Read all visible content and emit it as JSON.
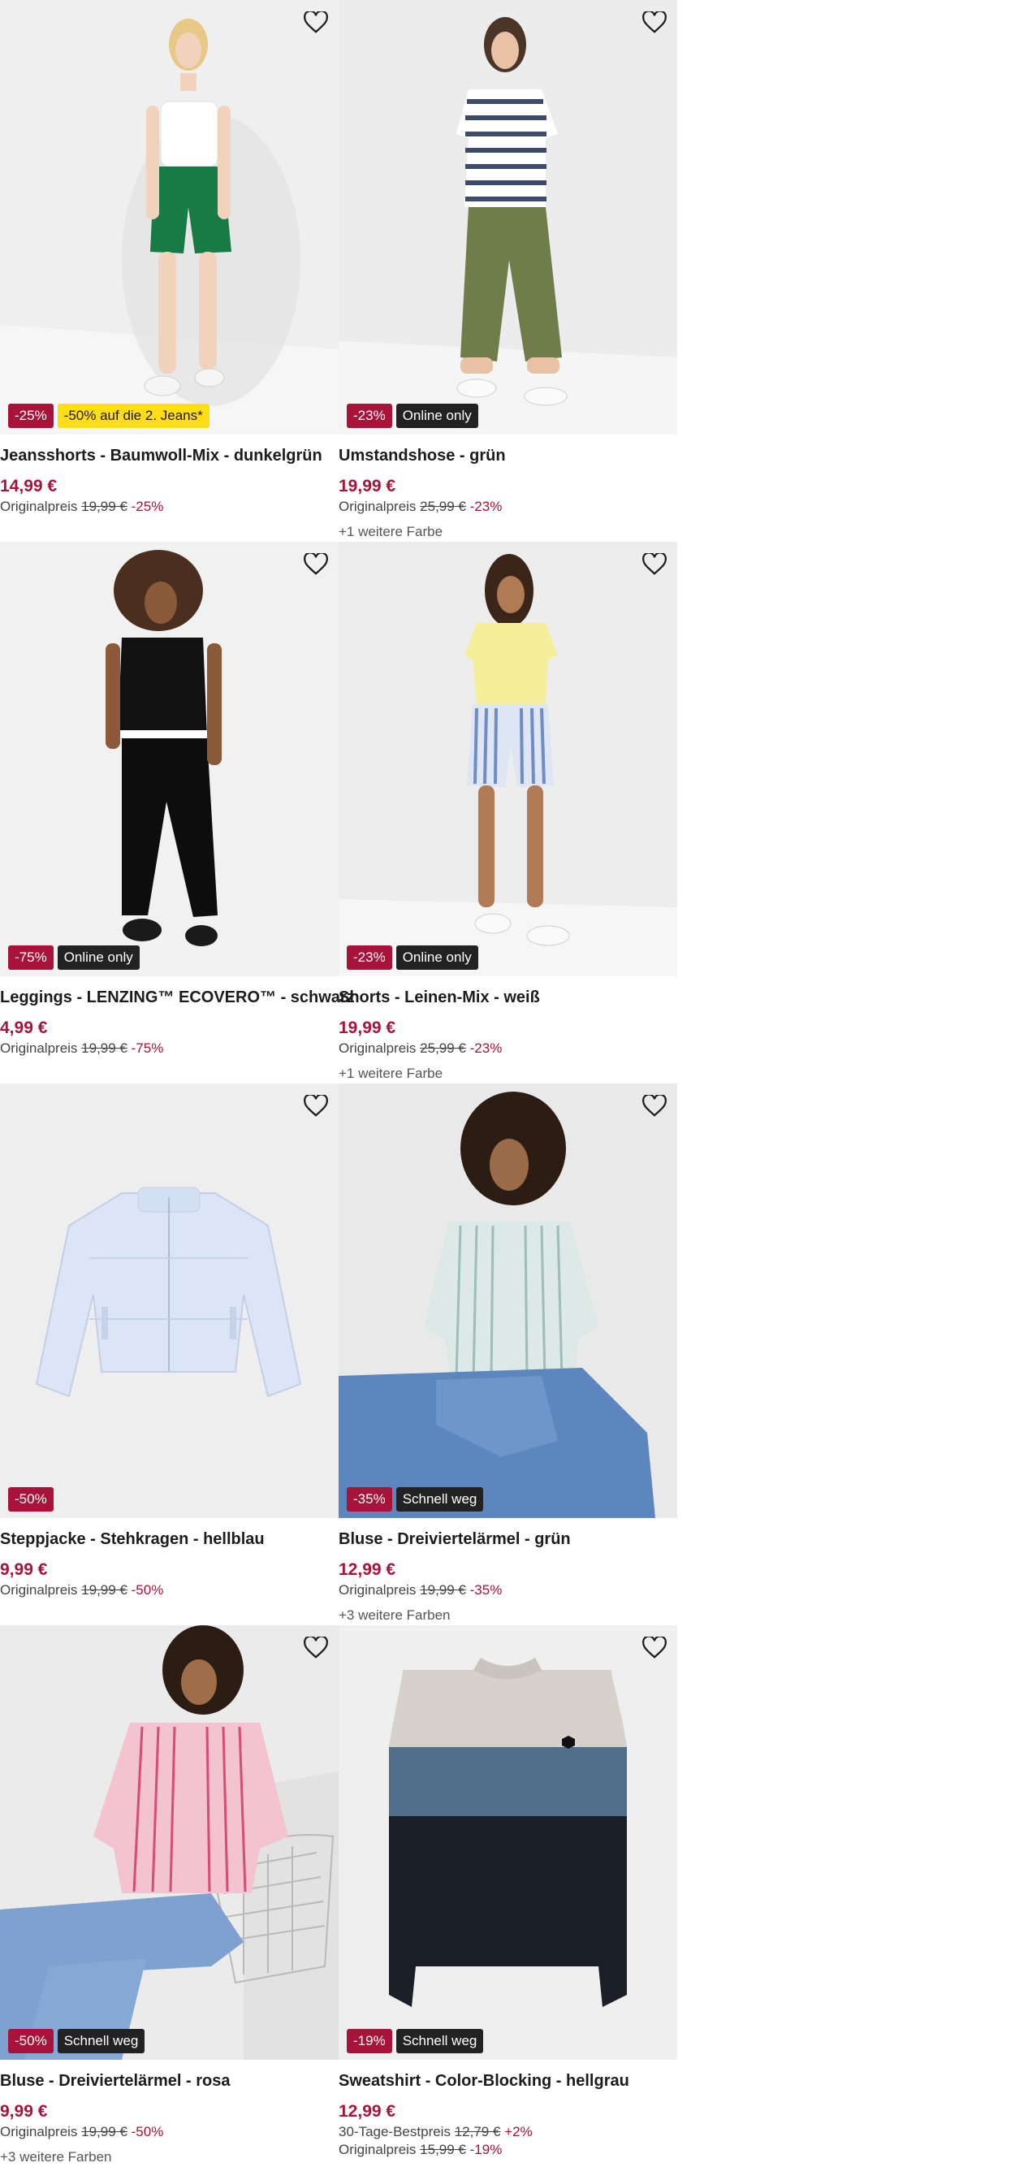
{
  "products": [
    {
      "title": "Jeansshorts - Baumwoll-Mix - dunkelgrün",
      "price": "14,99 €",
      "orig_label": "Originalpreis",
      "orig_price": "19,99 €",
      "orig_pct": "-25%",
      "badges": [
        "-25%",
        "-50% auf die 2. Jeans*"
      ],
      "more_colors": ""
    },
    {
      "title": "Umstandshose - grün",
      "price": "19,99 €",
      "orig_label": "Originalpreis",
      "orig_price": "25,99 €",
      "orig_pct": "-23%",
      "badges": [
        "-23%",
        "Online only"
      ],
      "more_colors": "+1 weitere Farbe"
    },
    {
      "title": "Leggings - LENZING™ ECOVERO™ - schwarz",
      "price": "4,99 €",
      "orig_label": "Originalpreis",
      "orig_price": "19,99 €",
      "orig_pct": "-75%",
      "badges": [
        "-75%",
        "Online only"
      ],
      "more_colors": ""
    },
    {
      "title": "Shorts - Leinen-Mix - weiß",
      "price": "19,99 €",
      "orig_label": "Originalpreis",
      "orig_price": "25,99 €",
      "orig_pct": "-23%",
      "badges": [
        "-23%",
        "Online only"
      ],
      "more_colors": "+1 weitere Farbe"
    },
    {
      "title": "Steppjacke - Stehkragen - hellblau",
      "price": "9,99 €",
      "orig_label": "Originalpreis",
      "orig_price": "19,99 €",
      "orig_pct": "-50%",
      "badges": [
        "-50%"
      ],
      "more_colors": ""
    },
    {
      "title": "Bluse - Dreiviertelärmel - grün",
      "price": "12,99 €",
      "orig_label": "Originalpreis",
      "orig_price": "19,99 €",
      "orig_pct": "-35%",
      "badges": [
        "-35%",
        "Schnell weg"
      ],
      "more_colors": "+3 weitere Farben"
    },
    {
      "title": "Bluse - Dreiviertelärmel - rosa",
      "price": "9,99 €",
      "orig_label": "Originalpreis",
      "orig_price": "19,99 €",
      "orig_pct": "-50%",
      "badges": [
        "-50%",
        "Schnell weg"
      ],
      "more_colors": "+3 weitere Farben"
    },
    {
      "title": "Sweatshirt - Color-Blocking - hellgrau",
      "price": "12,99 €",
      "orig_label": "30-Tage-Bestpreis",
      "orig_price": "12,79 €",
      "orig_pct": "+2%",
      "orig2_label": "Originalpreis",
      "orig2_price": "15,99 €",
      "orig2_pct": "-19%",
      "badges": [
        "-19%",
        "Schnell weg"
      ],
      "more_colors": ""
    }
  ],
  "icons": {
    "favorite": "heart-outline-icon"
  },
  "colors": {
    "discount": "#a8133a",
    "promo_yellow": "#ffde17",
    "dark_badge": "#222222",
    "image_bg": "#eeeeef"
  }
}
